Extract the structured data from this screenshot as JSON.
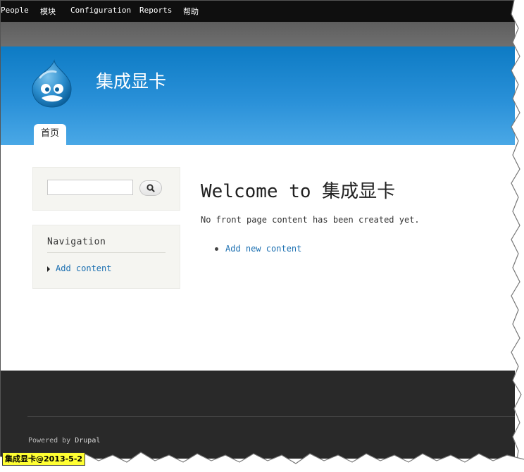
{
  "toolbar": {
    "items": [
      "People",
      "模块",
      "Configuration",
      "Reports",
      "帮助"
    ]
  },
  "header": {
    "site_name": "集成显卡",
    "tab_home": "首页"
  },
  "search": {
    "value": "",
    "button_icon": "magnifier-icon"
  },
  "navigation": {
    "title": "Navigation",
    "items": [
      "Add content"
    ]
  },
  "main": {
    "title": "Welcome to 集成显卡",
    "message": "No front page content has been created yet.",
    "links": [
      "Add new content"
    ]
  },
  "footer": {
    "powered_prefix": "Powered by ",
    "powered_link": "Drupal"
  },
  "stamp": "集成显卡@2013-5-2",
  "colors": {
    "toolbar": "#0f0f0f",
    "header": "#2990d8",
    "link": "#1b6fb1",
    "footer": "#292929"
  }
}
